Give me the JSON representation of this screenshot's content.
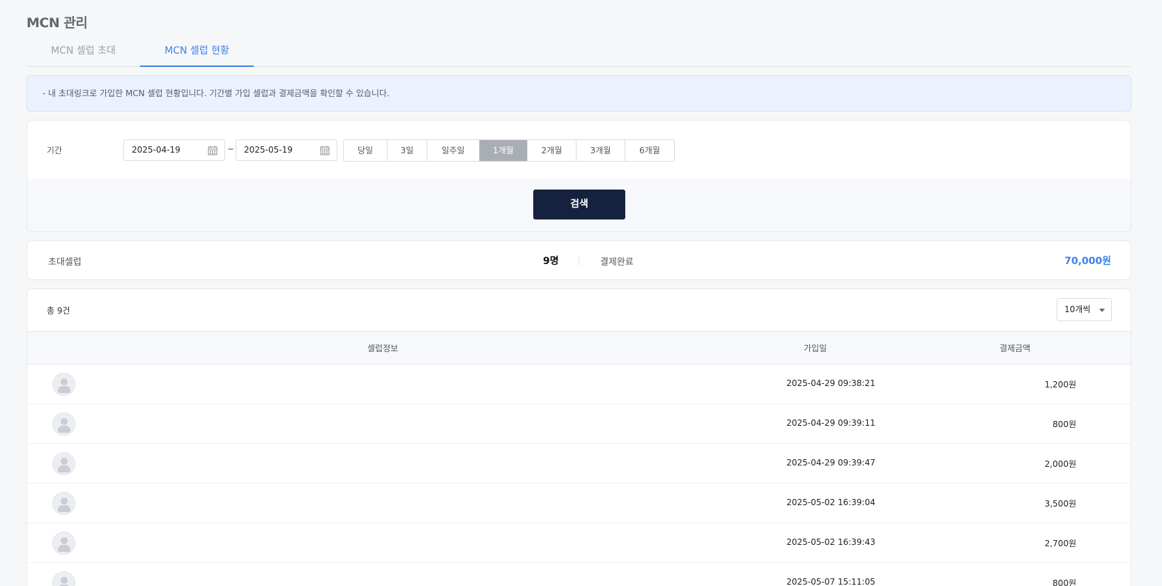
{
  "page": {
    "title": "MCN 관리"
  },
  "tabs": [
    {
      "label": "MCN 셀럽 초대",
      "active": false
    },
    {
      "label": "MCN 셀럽 현황",
      "active": true
    }
  ],
  "notice": {
    "text": "-  내 초대링크로 가입한 MCN 셀럽 현황입니다. 기간별 가입 셀럽과 결제금액을 확인할 수 있습니다."
  },
  "filter": {
    "period_label": "기간",
    "start_date": "2025-04-19",
    "end_date": "2025-05-19",
    "separator": "~",
    "period_buttons": [
      {
        "label": "당일",
        "active": false
      },
      {
        "label": "3일",
        "active": false
      },
      {
        "label": "일주일",
        "active": false
      },
      {
        "label": "1개월",
        "active": true
      },
      {
        "label": "2개월",
        "active": false
      },
      {
        "label": "3개월",
        "active": false
      },
      {
        "label": "6개월",
        "active": false
      }
    ],
    "search_label": "검색"
  },
  "summary": {
    "invited_label": "초대셀럽",
    "invited_value": "9명",
    "paid_label": "결제완료",
    "paid_value": "70,000원"
  },
  "list": {
    "total_text": "총 9건",
    "page_size": "10개씩",
    "headers": {
      "celeb_info": "셀럽정보",
      "join_date": "가입일",
      "amount": "결제금액"
    },
    "rows": [
      {
        "join_date": "2025-04-29 09:38:21",
        "amount": "1,200원"
      },
      {
        "join_date": "2025-04-29 09:39:11",
        "amount": "800원"
      },
      {
        "join_date": "2025-04-29 09:39:47",
        "amount": "2,000원"
      },
      {
        "join_date": "2025-05-02 16:39:04",
        "amount": "3,500원"
      },
      {
        "join_date": "2025-05-02 16:39:43",
        "amount": "2,700원"
      },
      {
        "join_date": "2025-05-07 15:11:05",
        "amount": "800원"
      }
    ]
  },
  "colors": {
    "accent": "#3b82e6",
    "search_button": "#15223f",
    "active_period": "#a9aeb5",
    "notice_bg": "#ebf2fd"
  },
  "icons": {
    "date_picker": "calendar-icon",
    "avatar": "user-avatar-icon",
    "dropdown": "chevron-down-icon"
  }
}
